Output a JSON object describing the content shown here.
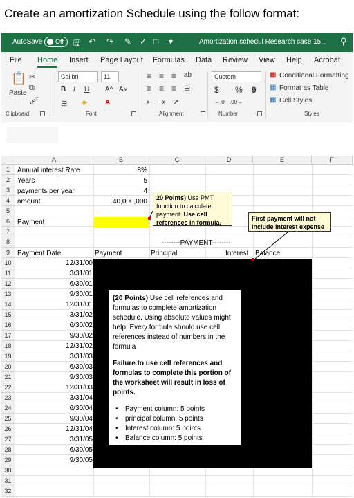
{
  "heading": "Create an amortization Schedule using the follow format:",
  "titlebar": {
    "autosave_label": "AutoSave",
    "autosave_state": "Off",
    "document_title": "Amortization schedul Research case 15...",
    "accent_color": "#1e7145"
  },
  "tabs": [
    "File",
    "Home",
    "Insert",
    "Page Layout",
    "Formulas",
    "Data",
    "Review",
    "View",
    "Help",
    "Acrobat"
  ],
  "ribbon": {
    "clipboard": {
      "paste": "Paste",
      "label": "Clipboard"
    },
    "font": {
      "name": "Calibri",
      "size": "11",
      "bold": "B",
      "italic": "I",
      "underline": "U",
      "grow": "A^",
      "shrink": "A˅",
      "label": "Font"
    },
    "alignment": {
      "label": "Alignment"
    },
    "number": {
      "format": "Custom",
      "currency": "$",
      "percent": "%",
      "comma": "9",
      "label": "Number"
    },
    "styles": {
      "conditional": "Conditional Formatting",
      "format_table": "Format as Table",
      "cell_styles": "Cell Styles",
      "label": "Styles"
    }
  },
  "columns": [
    "A",
    "B",
    "C",
    "D",
    "E",
    "F"
  ],
  "rows": [
    "1",
    "2",
    "3",
    "4",
    "5",
    "6",
    "7",
    "8",
    "9",
    "10",
    "11",
    "12",
    "13",
    "14",
    "15",
    "16",
    "17",
    "18",
    "19",
    "20",
    "21",
    "22",
    "23",
    "24",
    "25",
    "26",
    "27",
    "28",
    "29",
    "30",
    "31",
    "32"
  ],
  "cells": {
    "a1": "Annual interest Rate",
    "b1": "8%",
    "a2": "Years",
    "b2": "5",
    "a3": "payments per year",
    "b3": "4",
    "a4": "amount",
    "b4": "40,000,000",
    "a6": "Payment",
    "cd8": "--------PAYMENT--------",
    "a9": "Payment Date",
    "b9": "Payment",
    "c9": "Principal",
    "d9": "Interest",
    "e9": "Balance"
  },
  "dates": [
    "12/31/00",
    "3/31/01",
    "6/30/01",
    "9/30/01",
    "12/31/01",
    "3/31/02",
    "6/30/02",
    "9/30/02",
    "12/31/02",
    "3/31/03",
    "6/30/03",
    "9/30/03",
    "12/31/03",
    "3/31/04",
    "6/30/04",
    "9/30/04",
    "12/31/04",
    "3/31/05",
    "6/30/05",
    "9/30/05"
  ],
  "notes": {
    "pmt": {
      "points": "20 Points)",
      "text1": " Use PMT function to calculate payment.",
      "bold": "Use cell references in formula."
    },
    "first": "First payment will not include interest expense"
  },
  "instructions": {
    "intro_bold": "(20 Points)",
    "intro": "Use cell references and formulas to complete amortization schedule. Using absolute values might help. Every formula should use cell references instead of numbers in the formula",
    "warning": "Failure to use cell references and formulas to complete this portion of the worksheet will result in loss of points.",
    "bullets": [
      "Payment column: 5 points",
      "principal column: 5 points",
      "Interest column: 5 points",
      "Balance column: 5 points"
    ]
  }
}
